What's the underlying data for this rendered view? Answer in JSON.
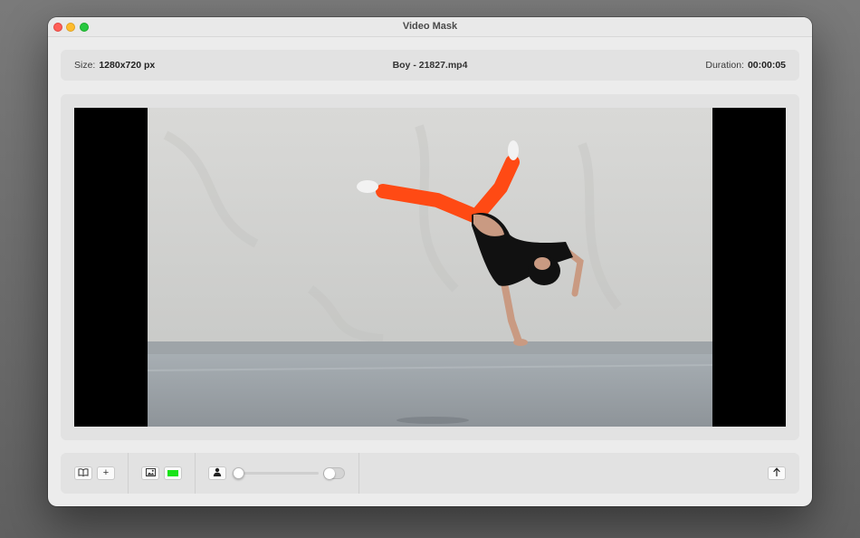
{
  "window": {
    "title": "Video Mask"
  },
  "info": {
    "size_label": "Size:",
    "size_value": "1280x720 px",
    "file_name": "Boy - 21827.mp4",
    "duration_label": "Duration:",
    "duration_value": "00:00:05"
  },
  "viewer": {
    "content": "video-frame-breakdancer"
  },
  "toolbar": {
    "icons": {
      "library": "book-icon",
      "add": "plus-icon",
      "background_image": "image-icon",
      "person": "person-icon",
      "export": "share-up-icon"
    },
    "background_color": "#19e319",
    "accent_color": "#2f7cf6",
    "add_glyph": "+",
    "slider_value": 0.03,
    "toggle_on": false
  }
}
